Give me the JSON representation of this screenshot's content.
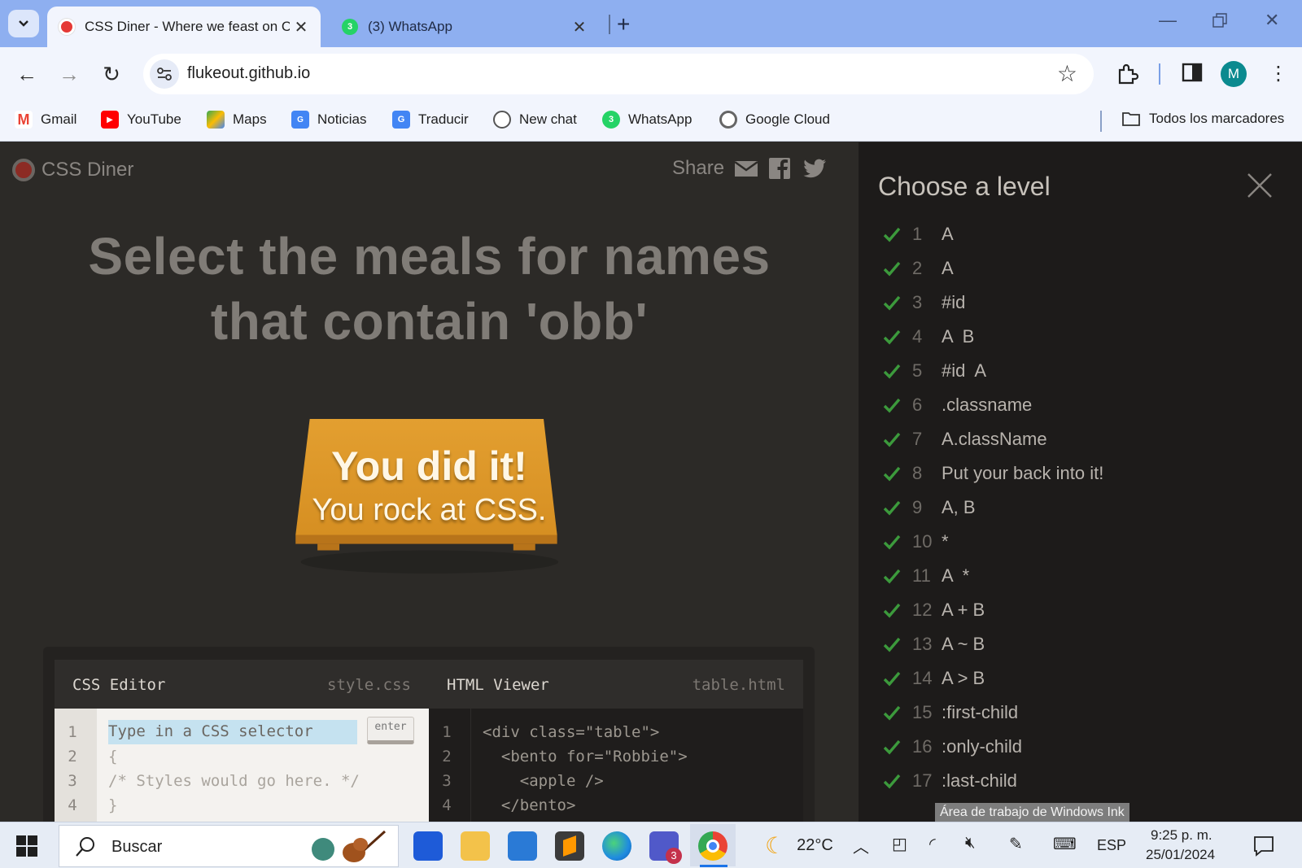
{
  "browser": {
    "tabs": [
      {
        "title": "CSS Diner - Where we feast on CSS",
        "active": true
      },
      {
        "title": "(3) WhatsApp",
        "active": false
      }
    ],
    "url": "flukeout.github.io",
    "profile_initial": "M",
    "bookmarks": [
      "Gmail",
      "YouTube",
      "Maps",
      "Noticias",
      "Traducir",
      "New chat",
      "WhatsApp",
      "Google Cloud"
    ],
    "all_bookmarks": "Todos los marcadores"
  },
  "site": {
    "brand": "CSS Diner",
    "share_label": "Share",
    "headline": "Select the meals for names that contain 'obb'",
    "table_line1": "You did it!",
    "table_line2": "You rock at CSS.",
    "colors": {
      "accent": "#e09b2d",
      "check": "#3c9a3c",
      "bg": "#2c2a27",
      "sidebar": "#1d1b1a"
    }
  },
  "css_editor": {
    "title": "CSS Editor",
    "filename": "style.css",
    "placeholder": "Type in a CSS selector",
    "enter_label": "enter",
    "line_numbers": [
      "1",
      "2",
      "3",
      "4"
    ],
    "lines": [
      "{",
      "/* Styles would go here. */",
      "}"
    ]
  },
  "html_viewer": {
    "title": "HTML Viewer",
    "filename": "table.html",
    "line_numbers": [
      "1",
      "2",
      "3",
      "4"
    ],
    "lines": [
      "<div class=\"table\">",
      "  <bento for=\"Robbie\">",
      "    <apple />",
      "  </bento>"
    ]
  },
  "levels_panel": {
    "title": "Choose a level",
    "levels": [
      {
        "num": "1",
        "selector": "A"
      },
      {
        "num": "2",
        "selector": "A"
      },
      {
        "num": "3",
        "selector": "#id"
      },
      {
        "num": "4",
        "selector": "A  B"
      },
      {
        "num": "5",
        "selector": "#id  A"
      },
      {
        "num": "6",
        "selector": ".classname"
      },
      {
        "num": "7",
        "selector": "A.className"
      },
      {
        "num": "8",
        "selector": "Put your back into it!"
      },
      {
        "num": "9",
        "selector": "A, B"
      },
      {
        "num": "10",
        "selector": "*"
      },
      {
        "num": "11",
        "selector": "A  *"
      },
      {
        "num": "12",
        "selector": "A + B"
      },
      {
        "num": "13",
        "selector": "A ~ B"
      },
      {
        "num": "14",
        "selector": "A > B"
      },
      {
        "num": "15",
        "selector": ":first-child"
      },
      {
        "num": "16",
        "selector": ":only-child"
      },
      {
        "num": "17",
        "selector": ":last-child"
      }
    ]
  },
  "tooltip": "Área de trabajo de Windows Ink",
  "taskbar": {
    "search_label": "Buscar",
    "weather": "22°C",
    "language": "ESP",
    "time": "9:25 p. m.",
    "date": "25/01/2024",
    "teams_badge": "3"
  }
}
